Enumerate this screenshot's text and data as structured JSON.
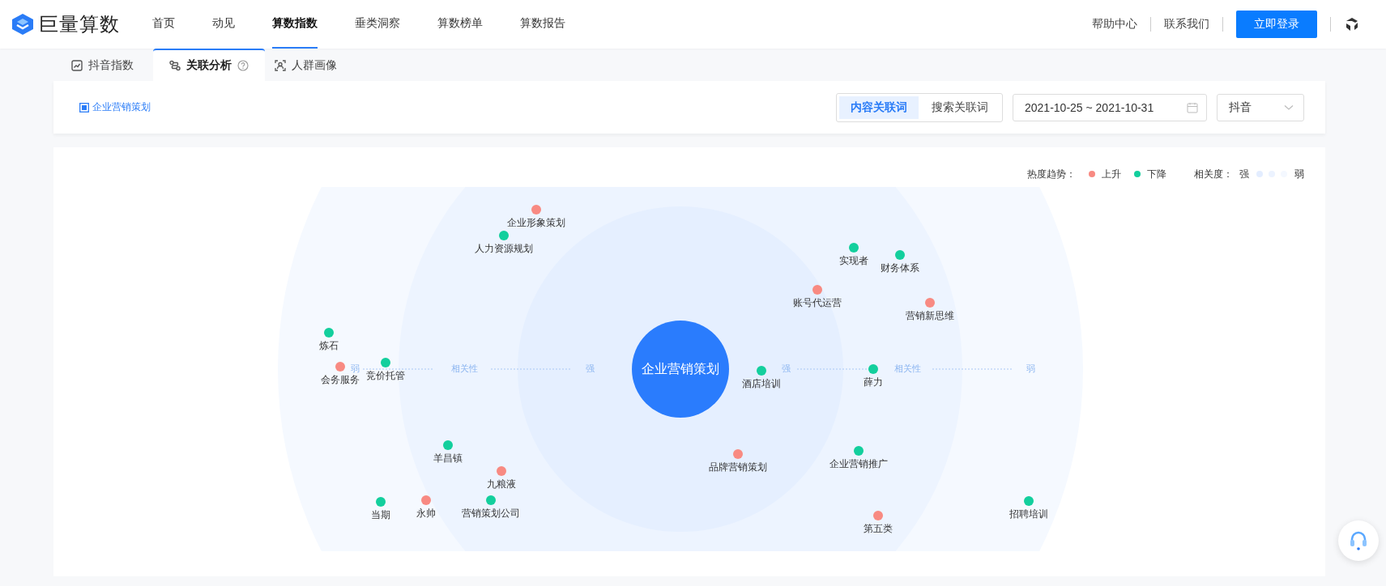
{
  "header": {
    "brand": "巨量算数",
    "nav": [
      {
        "label": "首页",
        "selected": false
      },
      {
        "label": "动见",
        "selected": false
      },
      {
        "label": "算数指数",
        "selected": true
      },
      {
        "label": "垂类洞察",
        "selected": false
      },
      {
        "label": "算数榜单",
        "selected": false
      },
      {
        "label": "算数报告",
        "selected": false
      }
    ],
    "links": [
      "帮助中心",
      "联系我们"
    ],
    "login_button": "立即登录"
  },
  "tabs": [
    {
      "label": "抖音指数",
      "selected": false,
      "kind": "trend"
    },
    {
      "label": "关联分析",
      "selected": true,
      "kind": "relation"
    },
    {
      "label": "人群画像",
      "selected": false,
      "kind": "crowd"
    }
  ],
  "filter": {
    "keyword": "企业营销策划",
    "segments": [
      {
        "label": "内容关联词",
        "selected": true
      },
      {
        "label": "搜索关联词",
        "selected": false
      }
    ],
    "date_range": "2021-10-25 ~ 2021-10-31",
    "platform": "抖音"
  },
  "legend": {
    "trend_title": "热度趋势：",
    "trend_items": [
      {
        "label": "上升",
        "color": "#f88a82"
      },
      {
        "label": "下降",
        "color": "#13cf9d"
      }
    ],
    "relevance_title": "相关度：",
    "strong": "强",
    "weak": "弱"
  },
  "graph": {
    "center": "企业营销策划",
    "axis": {
      "left_weak": "弱",
      "left_label": "相关性",
      "left_strong": "强",
      "right_strong": "强",
      "right_label": "相关性",
      "right_weak": "弱"
    },
    "nodes": [
      {
        "label": "企业形象策划",
        "rising": true
      },
      {
        "label": "人力资源规划",
        "rising": false
      },
      {
        "label": "实现者",
        "rising": false
      },
      {
        "label": "财务体系",
        "rising": false
      },
      {
        "label": "账号代运营",
        "rising": true
      },
      {
        "label": "营销新思维",
        "rising": true
      },
      {
        "label": "炼石",
        "rising": false
      },
      {
        "label": "会务服务",
        "rising": true
      },
      {
        "label": "竞价托管",
        "rising": false
      },
      {
        "label": "酒店培训",
        "rising": false
      },
      {
        "label": "薛力",
        "rising": false
      },
      {
        "label": "羊昌镇",
        "rising": false
      },
      {
        "label": "九粮液",
        "rising": true
      },
      {
        "label": "当期",
        "rising": false
      },
      {
        "label": "永帅",
        "rising": true
      },
      {
        "label": "营销策划公司",
        "rising": false
      },
      {
        "label": "品牌营销策划",
        "rising": true
      },
      {
        "label": "企业营销推广",
        "rising": false
      },
      {
        "label": "第五类",
        "rising": true
      },
      {
        "label": "招聘培训",
        "rising": false
      }
    ]
  }
}
